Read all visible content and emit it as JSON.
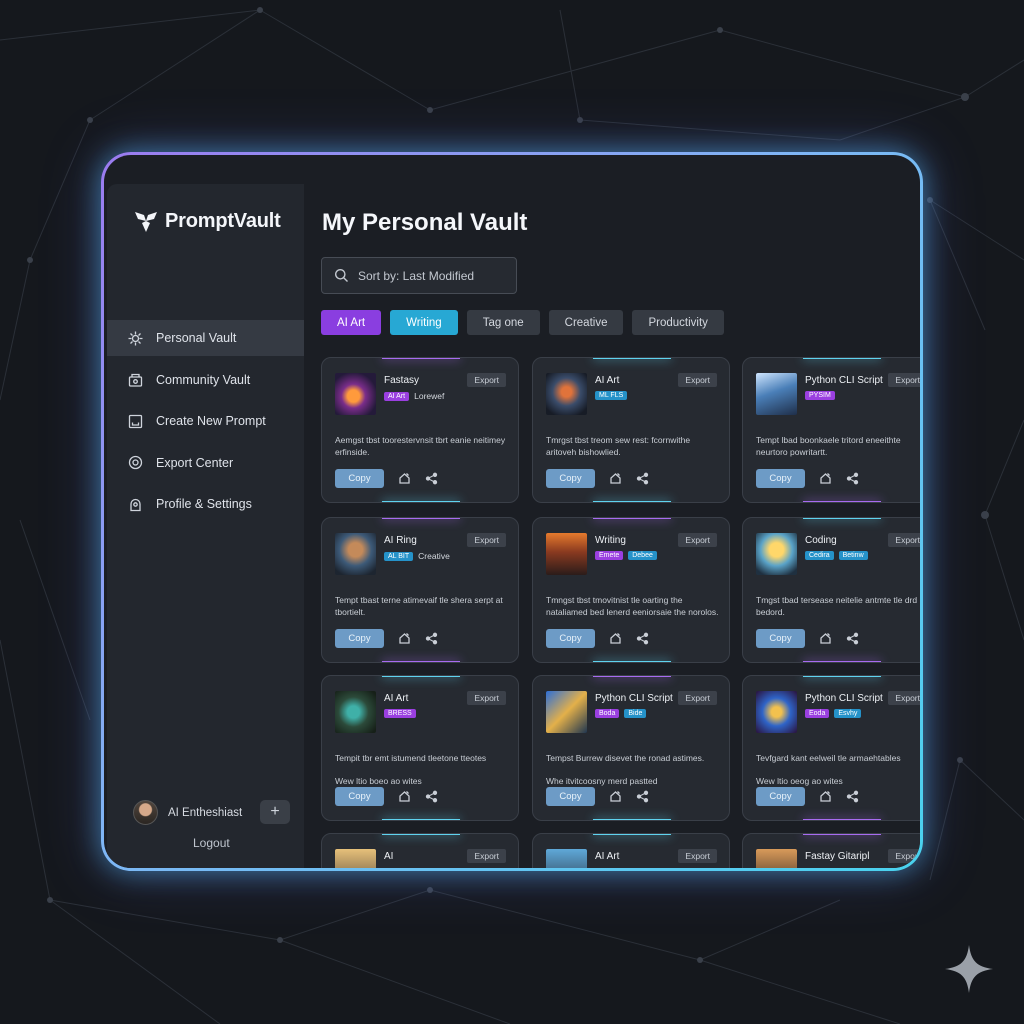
{
  "app": {
    "name": "PromptVault",
    "accent_purple": "#8a3ee0",
    "accent_cyan": "#27a8d4"
  },
  "sidebar": {
    "items": [
      {
        "label": "Personal Vault",
        "icon": "vault-icon",
        "active": true
      },
      {
        "label": "Community Vault",
        "icon": "community-icon",
        "active": false
      },
      {
        "label": "Create New Prompt",
        "icon": "create-icon",
        "active": false
      },
      {
        "label": "Export Center",
        "icon": "export-icon",
        "active": false
      },
      {
        "label": "Profile & Settings",
        "icon": "profile-icon",
        "active": false
      }
    ],
    "user_name": "AI Entheshiast",
    "add_label": "+",
    "logout_label": "Logout"
  },
  "main": {
    "title": "My Personal Vault",
    "sort_label": "Sort by: Last Modified",
    "tags": [
      {
        "label": "AI Art",
        "style": "purple"
      },
      {
        "label": "Writing",
        "style": "cyan"
      },
      {
        "label": "Tag one",
        "style": "plain"
      },
      {
        "label": "Creative",
        "style": "plain"
      },
      {
        "label": "Productivity",
        "style": "plain"
      }
    ]
  },
  "cards": [
    {
      "title": "Fastasy",
      "chips": [
        "AI Art"
      ],
      "extra": "Lorewef",
      "badge": "Export",
      "desc": "Aemgst tbst toorestervnsit tbrt eanie neitimey erfinside.",
      "copy": "Copy"
    },
    {
      "title": "AI Art",
      "chips": [
        "ML FLS"
      ],
      "extra": "",
      "badge": "Export",
      "desc": "Tmrgst tbst treom sew rest: fcornwithe aritoveh bishowlied.",
      "copy": "Copy"
    },
    {
      "title": "Python CLI Script",
      "chips": [
        "PYSIM"
      ],
      "extra": "",
      "badge": "Export",
      "desc": "Tempt lbad boonkaele tritord eneeithte neurtoro powritartt.",
      "copy": "Copy"
    },
    {
      "title": "AI Ring",
      "chips": [
        "AL BIT"
      ],
      "extra": "Creative",
      "badge": "Export",
      "desc": "Tempt tbast terne atimevaif tle shera serpt at tbortielt.",
      "copy": "Copy"
    },
    {
      "title": "Writing",
      "chips": [
        "Emete",
        "Debee"
      ],
      "extra": "",
      "badge": "Export",
      "desc": "Tmngst tbst tmovitnist tle oarting the nataliamed bed lenerd eeniorsaie the norolos.",
      "copy": "Copy"
    },
    {
      "title": "Coding",
      "chips": [
        "Cedira",
        "Betinw"
      ],
      "extra": "",
      "badge": "Export",
      "desc": "Tmgst tbad tersease neitelie antmte tle drd bedord.",
      "copy": "Copy"
    },
    {
      "title": "AI Art",
      "chips": [
        "BRESS"
      ],
      "extra": "",
      "badge": "Export",
      "desc": "Tempit tbr emt istumend tleetone tteotes",
      "note": "Wew ltio boeo ao wites",
      "copy": "Copy"
    },
    {
      "title": "Python CLI Script",
      "chips": [
        "Boda",
        "Bide"
      ],
      "extra": "",
      "badge": "Export",
      "desc": "Tempst Burrew disevet the ronad astimes.",
      "note": "Whe itvitcoosny merd pastted",
      "copy": "Copy"
    },
    {
      "title": "Python CLI Script",
      "chips": [
        "Eoda",
        "Esvhy"
      ],
      "extra": "",
      "badge": "Export",
      "desc": "Tevfgard kant eelweil tle armaehtables",
      "note": "Wew ltio oeog ao wites",
      "copy": "Copy"
    },
    {
      "title": "AI",
      "chips": [],
      "extra": "",
      "badge": "Export",
      "desc": "",
      "copy": ""
    },
    {
      "title": "AI Art",
      "chips": [],
      "extra": "",
      "badge": "Export",
      "desc": "",
      "copy": ""
    },
    {
      "title": "Fastay Gitaripl",
      "chips": [],
      "extra": "",
      "badge": "Export",
      "desc": "",
      "copy": ""
    }
  ]
}
